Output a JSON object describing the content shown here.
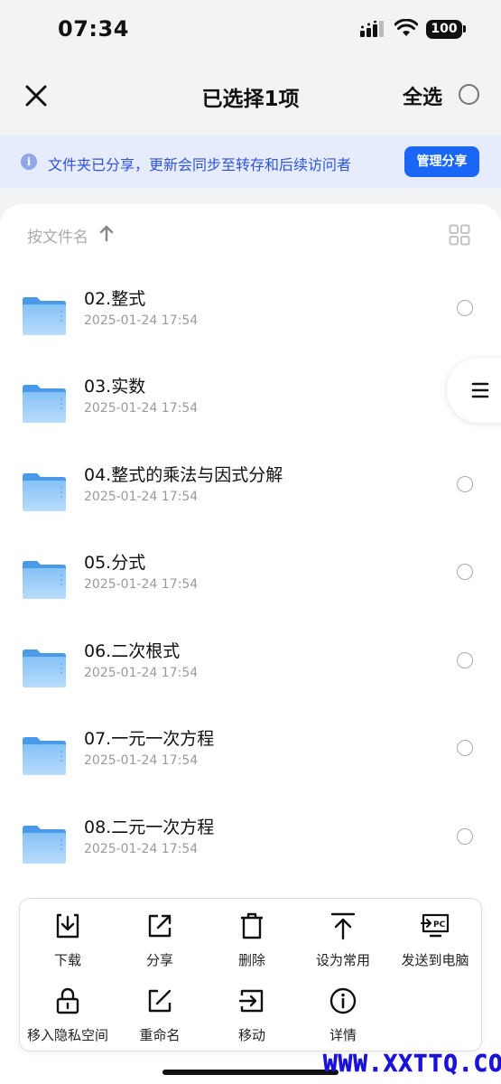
{
  "status_bar": {
    "time": "07:34",
    "battery": "100"
  },
  "header": {
    "title": "已选择1项",
    "select_all": "全选"
  },
  "banner": {
    "text": "文件夹已分享，更新会同步至转存和后续访问者",
    "button": "管理分享",
    "info_glyph": "i"
  },
  "list": {
    "sort_label": "按文件名",
    "items": [
      {
        "name": "02.整式",
        "date": "2025-01-24 17:54"
      },
      {
        "name": "03.实数",
        "date": "2025-01-24 17:54"
      },
      {
        "name": "04.整式的乘法与因式分解",
        "date": "2025-01-24 17:54"
      },
      {
        "name": "05.分式",
        "date": "2025-01-24 17:54"
      },
      {
        "name": "06.二次根式",
        "date": "2025-01-24 17:54"
      },
      {
        "name": "07.一元一次方程",
        "date": "2025-01-24 17:54"
      },
      {
        "name": "08.二元一次方程",
        "date": "2025-01-24 17:54"
      }
    ]
  },
  "actions": [
    {
      "label": "下载",
      "icon": "download-icon"
    },
    {
      "label": "分享",
      "icon": "share-icon"
    },
    {
      "label": "删除",
      "icon": "trash-icon"
    },
    {
      "label": "设为常用",
      "icon": "pin-top-icon"
    },
    {
      "label": "发送到电脑",
      "icon": "send-to-pc-icon"
    },
    {
      "label": "移入隐私空间",
      "icon": "lock-icon"
    },
    {
      "label": "重命名",
      "icon": "rename-icon"
    },
    {
      "label": "移动",
      "icon": "move-icon"
    },
    {
      "label": "详情",
      "icon": "info-icon"
    }
  ],
  "watermark": "WWW.XXTTQ.COM",
  "colors": {
    "accent": "#1967f4",
    "banner_bg": "#e6ecfb",
    "folder": "#6fb1f2"
  }
}
